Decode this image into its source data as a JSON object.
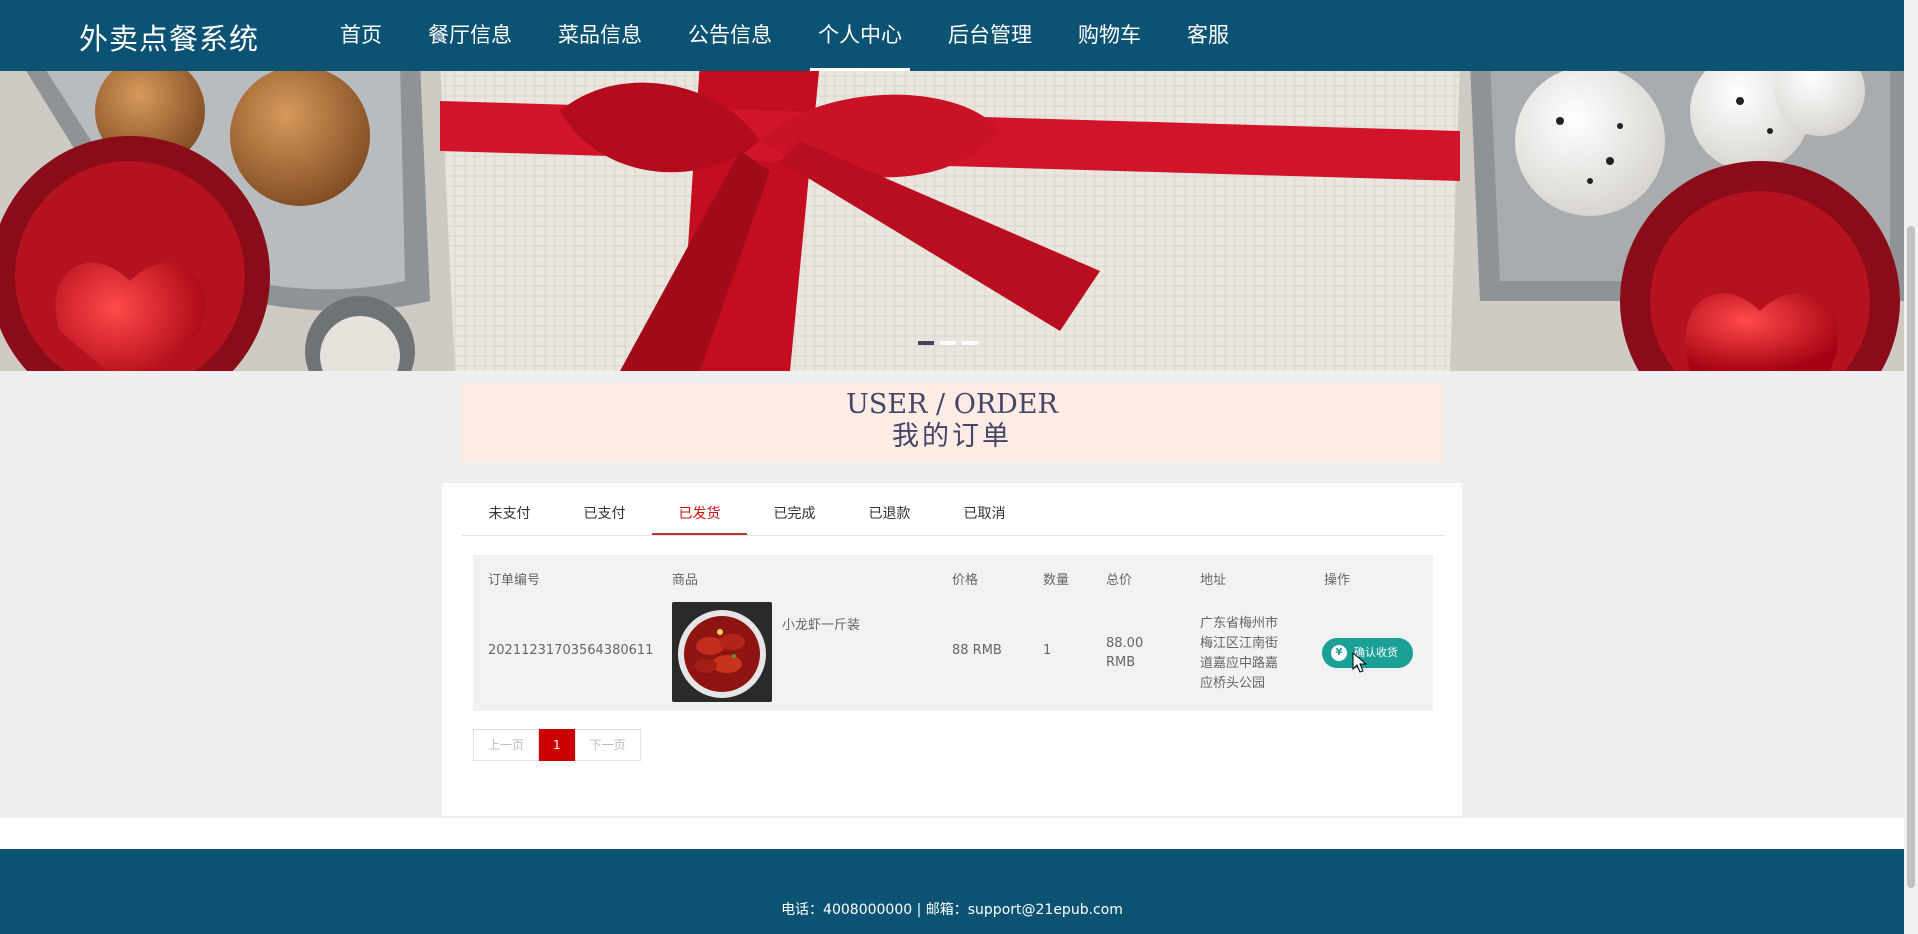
{
  "header": {
    "brand": "外卖点餐系统",
    "nav": [
      "首页",
      "餐厅信息",
      "菜品信息",
      "公告信息",
      "个人中心",
      "后台管理",
      "购物车",
      "客服"
    ],
    "active_nav": "个人中心"
  },
  "banner": {
    "slide_count": 3,
    "active_slide": 1
  },
  "page_title": {
    "en": "USER / ORDER",
    "cn": "我的订单"
  },
  "tabs": [
    "未支付",
    "已支付",
    "已发货",
    "已完成",
    "已退款",
    "已取消"
  ],
  "active_tab": "已发货",
  "table": {
    "headers": [
      "订单编号",
      "商品",
      "价格",
      "数量",
      "总价",
      "地址",
      "操作"
    ],
    "rows": [
      {
        "order_no": "20211231703564380611",
        "product": "小龙虾一斤装",
        "price": "88 RMB",
        "qty": "1",
        "total_line1": "88.00",
        "total_line2": "RMB",
        "address": [
          "广东省梅州市",
          "梅江区江南街",
          "道嘉应中路嘉",
          "应桥头公园"
        ],
        "action": "确认收货"
      }
    ]
  },
  "pager": {
    "prev": "上一页",
    "current": "1",
    "next": "下一页"
  },
  "footer": {
    "text": "电话：4008000000 | 邮箱：support@21epub.com"
  },
  "colors": {
    "header_bg": "#0c5273",
    "accent_red": "#c00",
    "action_green": "#1aa094"
  }
}
